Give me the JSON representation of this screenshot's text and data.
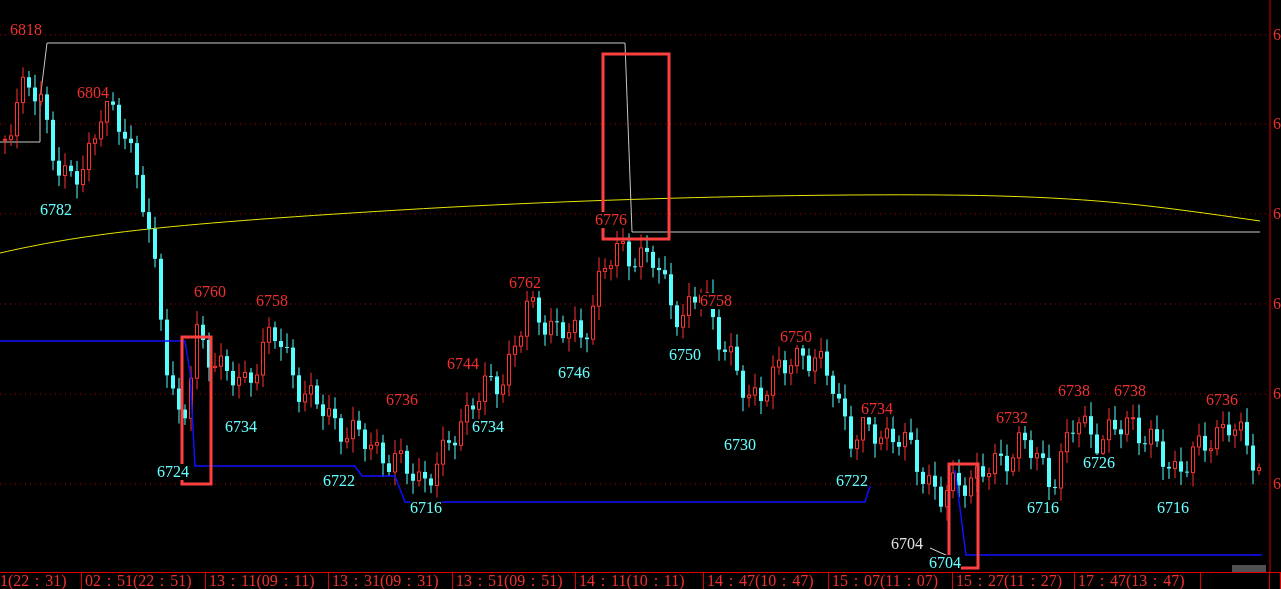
{
  "price_labels": [
    {
      "text": "6818",
      "kind": "high"
    },
    {
      "text": "6782",
      "kind": "low"
    },
    {
      "text": "6804",
      "kind": "high"
    },
    {
      "text": "6724",
      "kind": "low"
    },
    {
      "text": "6760",
      "kind": "high"
    },
    {
      "text": "6734",
      "kind": "low"
    },
    {
      "text": "6758",
      "kind": "high"
    },
    {
      "text": "6722",
      "kind": "low"
    },
    {
      "text": "6736",
      "kind": "high"
    },
    {
      "text": "6716",
      "kind": "low"
    },
    {
      "text": "6744",
      "kind": "high"
    },
    {
      "text": "6734",
      "kind": "low"
    },
    {
      "text": "6762",
      "kind": "high"
    },
    {
      "text": "6746",
      "kind": "low"
    },
    {
      "text": "6776",
      "kind": "high"
    },
    {
      "text": "6750",
      "kind": "low"
    },
    {
      "text": "6758",
      "kind": "high"
    },
    {
      "text": "6730",
      "kind": "low"
    },
    {
      "text": "6750",
      "kind": "high"
    },
    {
      "text": "6734",
      "kind": "high"
    },
    {
      "text": "6722",
      "kind": "low"
    },
    {
      "text": "6704",
      "kind": "pointer"
    },
    {
      "text": "6704",
      "kind": "low"
    },
    {
      "text": "6732",
      "kind": "high"
    },
    {
      "text": "6716",
      "kind": "low"
    },
    {
      "text": "6738",
      "kind": "high"
    },
    {
      "text": "6726",
      "kind": "low"
    },
    {
      "text": "6738",
      "kind": "high"
    },
    {
      "text": "6716",
      "kind": "low"
    },
    {
      "text": "6736",
      "kind": "high"
    }
  ],
  "y_axis_labels": [
    "6",
    "6",
    "6",
    "6",
    "6",
    "6"
  ],
  "time_axis_labels": [
    "1(22：31)",
    "02：51(22：51)",
    "13：11(09：11)",
    "13：31(09：31)",
    "13：51(09：51)",
    "14：11(10：11)",
    "14：47(10：47)",
    "15：07(11：07)",
    "15：27(11：27)",
    "17：47(13：47)"
  ]
}
